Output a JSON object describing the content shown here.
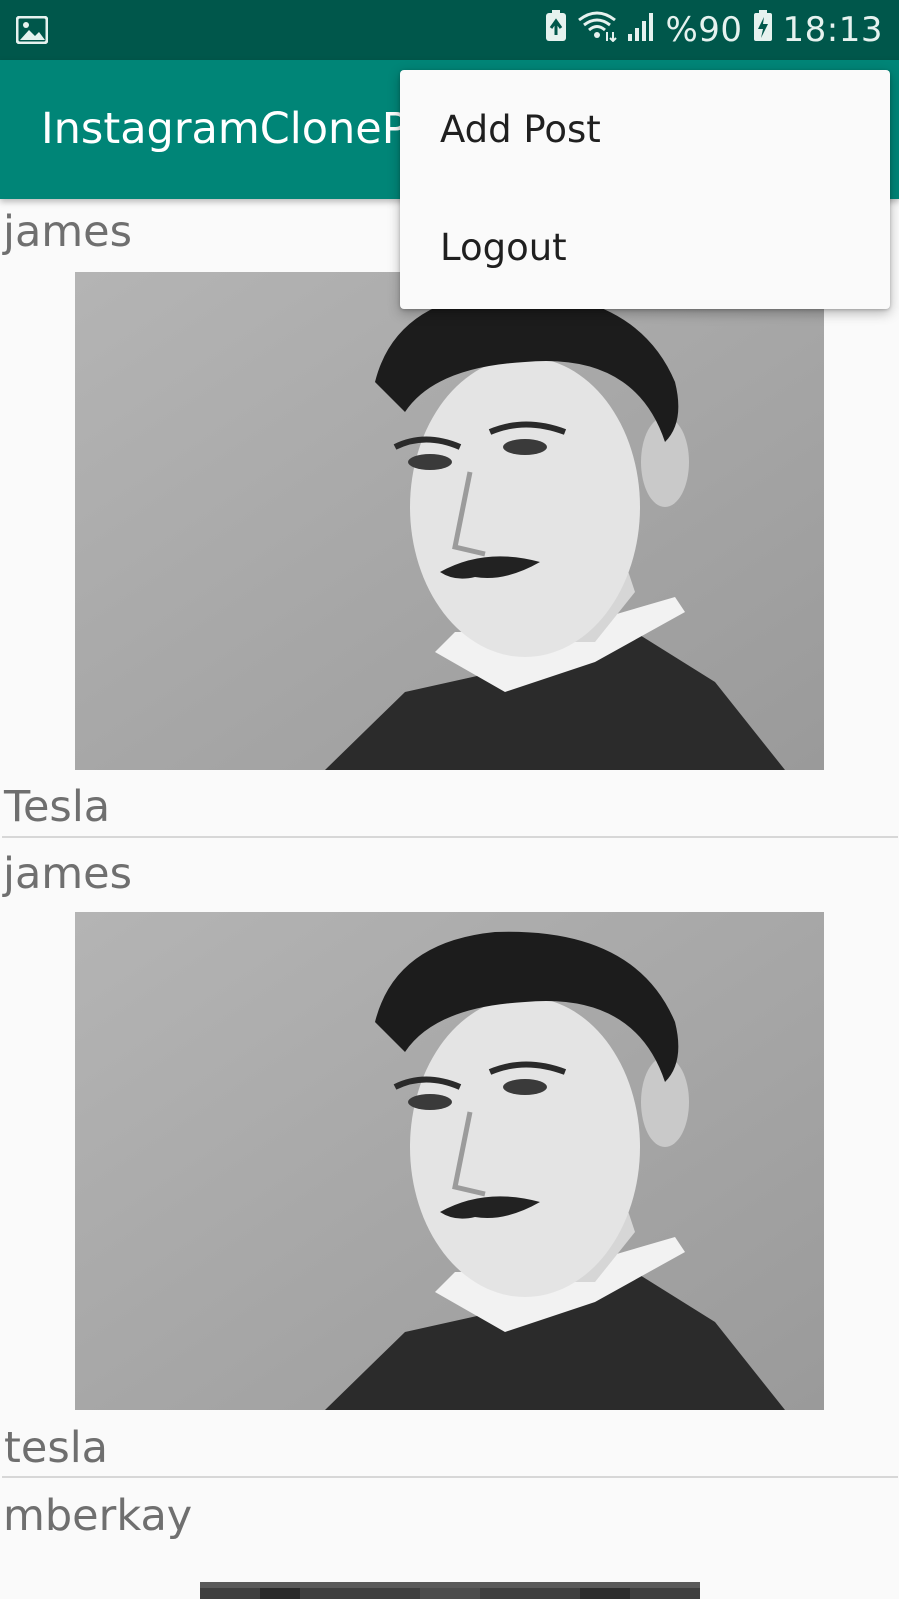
{
  "status_bar": {
    "time": "18:13",
    "battery_text": "%90",
    "icons": [
      "image-notification-icon",
      "battery-saver-icon",
      "wifi-icon",
      "signal-icon",
      "battery-charging-icon"
    ]
  },
  "app_bar": {
    "title": "InstagramCloneParse",
    "background": "#008577",
    "status_bar_background": "#00574b"
  },
  "menu": {
    "items": [
      {
        "label": "Add Post"
      },
      {
        "label": "Logout"
      }
    ]
  },
  "feed": {
    "posts": [
      {
        "username": "james",
        "caption": "Tesla",
        "image": "portrait-photo"
      },
      {
        "username": "james",
        "caption": "tesla",
        "image": "portrait-photo"
      },
      {
        "username": "mberkay",
        "caption": "",
        "image": "photo"
      }
    ]
  }
}
